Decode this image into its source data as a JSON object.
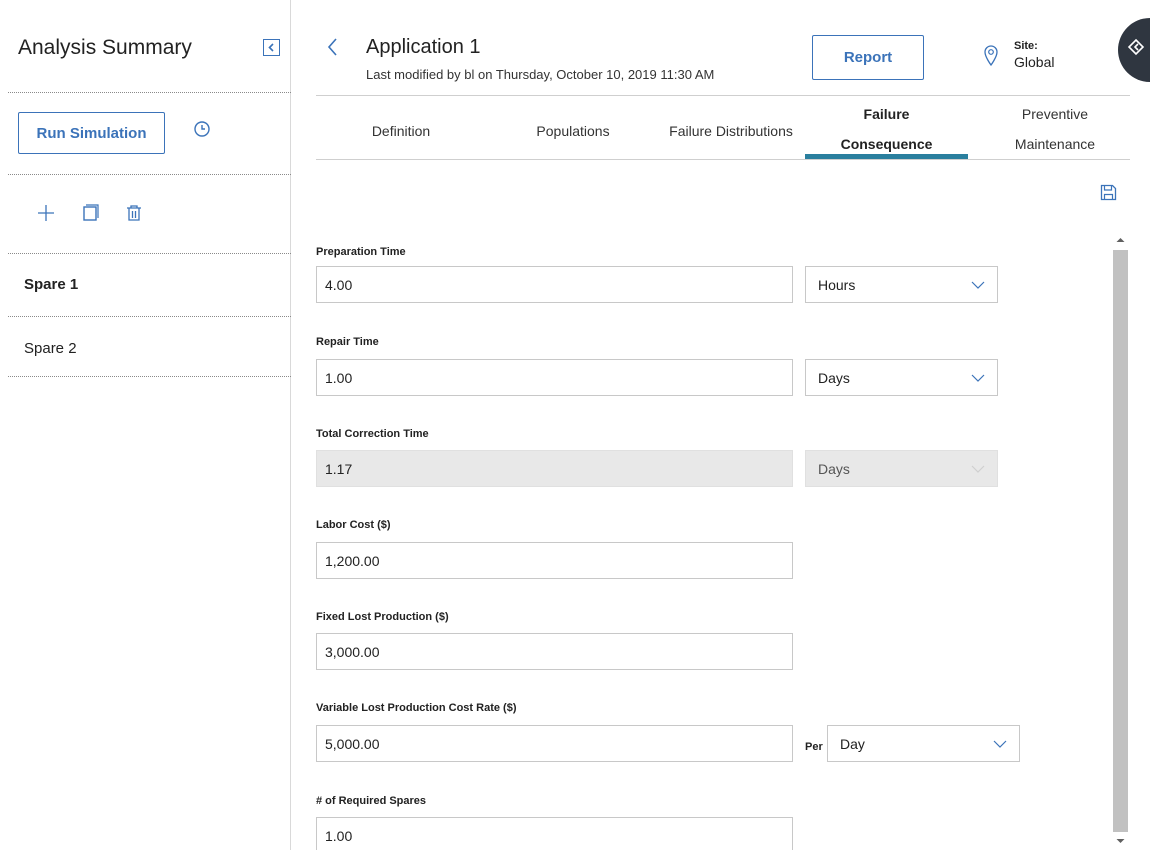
{
  "sidebar": {
    "title": "Analysis Summary",
    "run_label": "Run Simulation",
    "items": [
      {
        "label": "Spare 1"
      },
      {
        "label": "Spare 2"
      }
    ]
  },
  "header": {
    "title": "Application 1",
    "subtitle": "Last modified by bl on Thursday, October 10, 2019 11:30 AM",
    "report_label": "Report",
    "site_label": "Site:",
    "site_value": "Global"
  },
  "tabs": [
    {
      "line1": "Definition",
      "line2": ""
    },
    {
      "line1": "Populations",
      "line2": ""
    },
    {
      "line1": "Failure Distributions",
      "line2": ""
    },
    {
      "line1": "Failure",
      "line2": "Consequence"
    },
    {
      "line1": "Preventive",
      "line2": "Maintenance"
    }
  ],
  "form": {
    "preparation": {
      "label": "Preparation Time",
      "value": "4.00",
      "unit": "Hours"
    },
    "repair": {
      "label": "Repair Time",
      "value": "1.00",
      "unit": "Days"
    },
    "total": {
      "label": "Total Correction Time",
      "value": "1.17",
      "unit": "Days"
    },
    "labor": {
      "label": "Labor Cost ($)",
      "value": "1,200.00"
    },
    "fixed": {
      "label": "Fixed Lost Production ($)",
      "value": "3,000.00"
    },
    "variable": {
      "label": "Variable Lost Production Cost Rate ($)",
      "value": "5,000.00",
      "per_label": "Per",
      "unit": "Day"
    },
    "spares": {
      "label": "# of Required Spares",
      "value": "1.00"
    }
  },
  "colors": {
    "accent_blue": "#3b73b9",
    "tab_underline": "#2a7f9e",
    "fab_dark": "#2f3640"
  }
}
